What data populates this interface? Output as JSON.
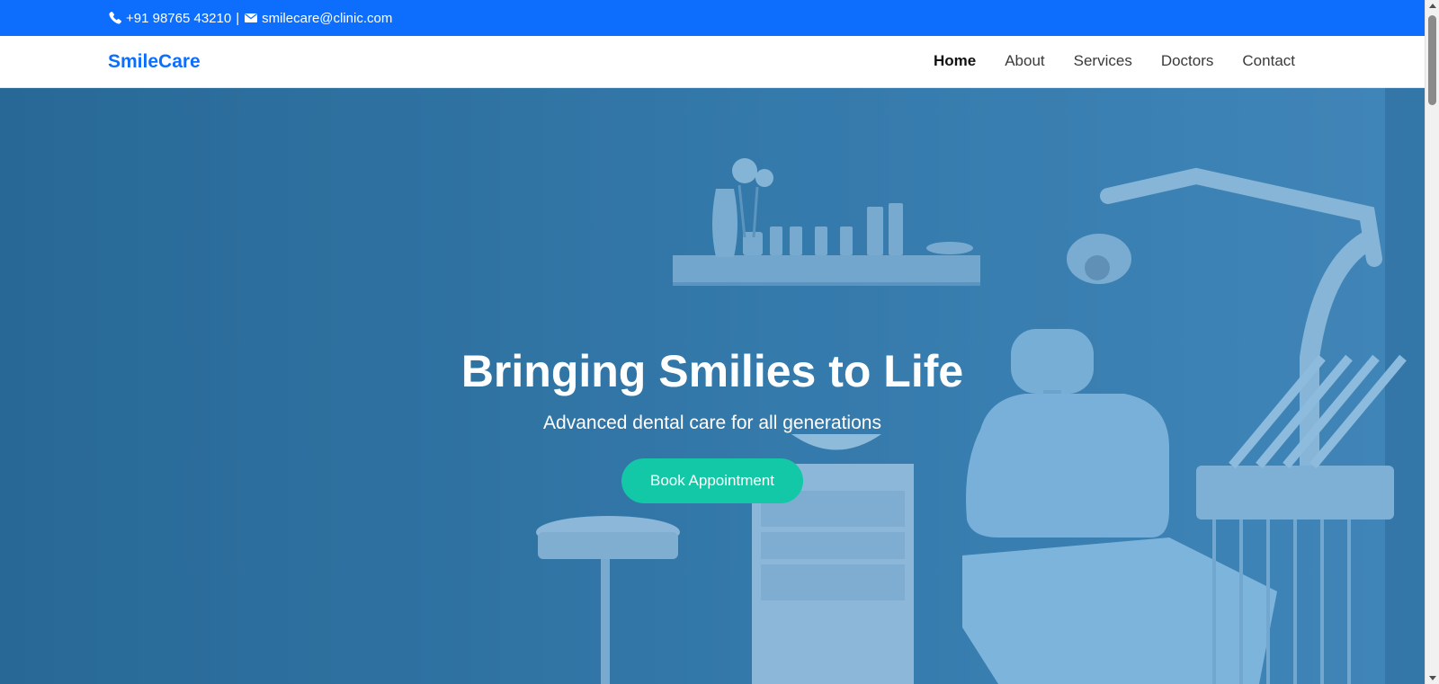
{
  "topbar": {
    "phone": "+91 98765 43210",
    "separator": "|",
    "email": "smilecare@clinic.com",
    "phone_icon": "phone-icon",
    "email_icon": "envelope-icon"
  },
  "navbar": {
    "brand": "SmileCare",
    "items": [
      {
        "label": "Home",
        "active": true
      },
      {
        "label": "About"
      },
      {
        "label": "Services"
      },
      {
        "label": "Doctors"
      },
      {
        "label": "Contact"
      }
    ]
  },
  "hero": {
    "title": "Bringing Smilies to Life",
    "subtitle": "Advanced dental care for all generations",
    "cta_label": "Book Appointment"
  },
  "colors": {
    "primary": "#0d6efd",
    "cta": "#12c8a6",
    "hero_overlay": "#3b7fae"
  }
}
